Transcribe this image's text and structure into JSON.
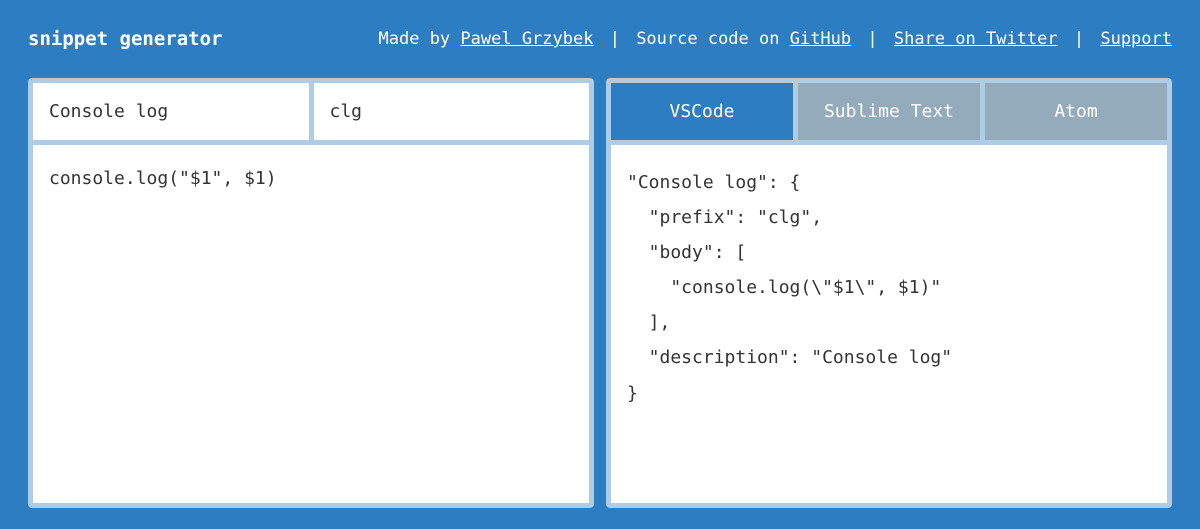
{
  "header": {
    "title": "snippet generator",
    "made_by_prefix": "Made by ",
    "author": "Pawel Grzybek",
    "source_prefix": "Source code on ",
    "source_link": "GitHub",
    "share_link": "Share on Twitter",
    "support_link": "Support",
    "separator": " | "
  },
  "input": {
    "description": "Console log",
    "trigger": "clg",
    "body": "console.log(\"$1\", $1)"
  },
  "tabs": [
    {
      "label": "VSCode",
      "active": true
    },
    {
      "label": "Sublime Text",
      "active": false
    },
    {
      "label": "Atom",
      "active": false
    }
  ],
  "output": "\"Console log\": {\n  \"prefix\": \"clg\",\n  \"body\": [\n    \"console.log(\\\"$1\\\", $1)\"\n  ],\n  \"description\": \"Console log\"\n}"
}
